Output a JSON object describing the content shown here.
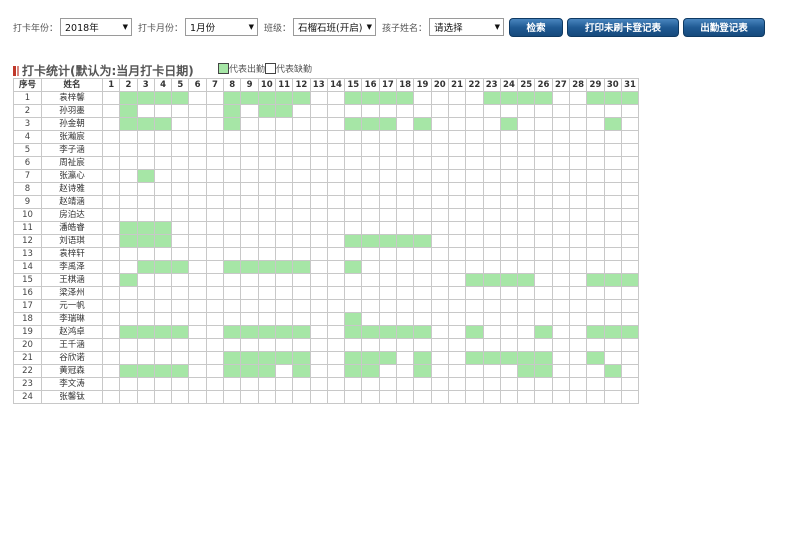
{
  "filters": {
    "year_label": "打卡年份：",
    "year_value": "2018年",
    "month_label": "打卡月份：",
    "month_value": "1月份",
    "class_label": "班级：",
    "class_value": "石榴石班(开启)",
    "child_label": "孩子姓名：",
    "child_value": "请选择"
  },
  "buttons": {
    "search": "检索",
    "print_unclocked": "打印未刷卡登记表",
    "attendance": "出勤登记表"
  },
  "section_title": "打卡统计(默认为:当月打卡日期)",
  "legend": {
    "present_label": "代表出勤",
    "absent_label": "代表缺勤",
    "present_color": "#a6e6a6"
  },
  "table": {
    "header_index": "序号",
    "header_name": "姓名",
    "days": [
      "1",
      "2",
      "3",
      "4",
      "5",
      "6",
      "7",
      "8",
      "9",
      "10",
      "11",
      "12",
      "13",
      "14",
      "15",
      "16",
      "17",
      "18",
      "19",
      "20",
      "21",
      "22",
      "23",
      "24",
      "25",
      "26",
      "27",
      "28",
      "29",
      "30",
      "31"
    ],
    "rows": [
      {
        "index": "1",
        "name": "袁梓馨",
        "present": [
          2,
          3,
          4,
          5,
          8,
          9,
          10,
          11,
          12,
          15,
          16,
          17,
          18,
          23,
          24,
          25,
          26,
          29,
          30,
          31
        ]
      },
      {
        "index": "2",
        "name": "孙羽墨",
        "present": [
          2,
          8,
          10,
          11
        ]
      },
      {
        "index": "3",
        "name": "孙金朝",
        "present": [
          2,
          3,
          4,
          8,
          15,
          16,
          17,
          19,
          24,
          30
        ]
      },
      {
        "index": "4",
        "name": "张瀚宸",
        "present": []
      },
      {
        "index": "5",
        "name": "李子涵",
        "present": []
      },
      {
        "index": "6",
        "name": "周祉宸",
        "present": []
      },
      {
        "index": "7",
        "name": "张瀛心",
        "present": [
          3
        ]
      },
      {
        "index": "8",
        "name": "赵诗雅",
        "present": []
      },
      {
        "index": "9",
        "name": "赵靖涵",
        "present": []
      },
      {
        "index": "10",
        "name": "房泊达",
        "present": []
      },
      {
        "index": "11",
        "name": "潘皓睿",
        "present": [
          2,
          3,
          4
        ]
      },
      {
        "index": "12",
        "name": "刘语琪",
        "present": [
          2,
          3,
          4,
          15,
          16,
          17,
          18,
          19
        ]
      },
      {
        "index": "13",
        "name": "袁梓轩",
        "present": []
      },
      {
        "index": "14",
        "name": "李禹泽",
        "present": [
          3,
          4,
          5,
          8,
          9,
          10,
          11,
          12,
          15
        ]
      },
      {
        "index": "15",
        "name": "王棋涵",
        "present": [
          2,
          22,
          23,
          24,
          25,
          29,
          30,
          31
        ]
      },
      {
        "index": "16",
        "name": "梁泽州",
        "present": []
      },
      {
        "index": "17",
        "name": "元一帆",
        "present": []
      },
      {
        "index": "18",
        "name": "李瑞琳",
        "present": [
          15
        ]
      },
      {
        "index": "19",
        "name": "赵鸿卓",
        "present": [
          2,
          3,
          4,
          5,
          8,
          9,
          10,
          11,
          12,
          15,
          16,
          17,
          18,
          19,
          22,
          26,
          29,
          30,
          31
        ]
      },
      {
        "index": "20",
        "name": "王千涵",
        "present": []
      },
      {
        "index": "21",
        "name": "谷欣诺",
        "present": [
          8,
          9,
          10,
          11,
          12,
          15,
          16,
          17,
          19,
          22,
          23,
          24,
          25,
          26,
          29
        ]
      },
      {
        "index": "22",
        "name": "黄冠森",
        "present": [
          2,
          3,
          4,
          5,
          8,
          9,
          10,
          12,
          15,
          16,
          19,
          25,
          26,
          30
        ]
      },
      {
        "index": "23",
        "name": "李文涛",
        "present": []
      },
      {
        "index": "24",
        "name": "张馨钛",
        "present": []
      }
    ]
  }
}
